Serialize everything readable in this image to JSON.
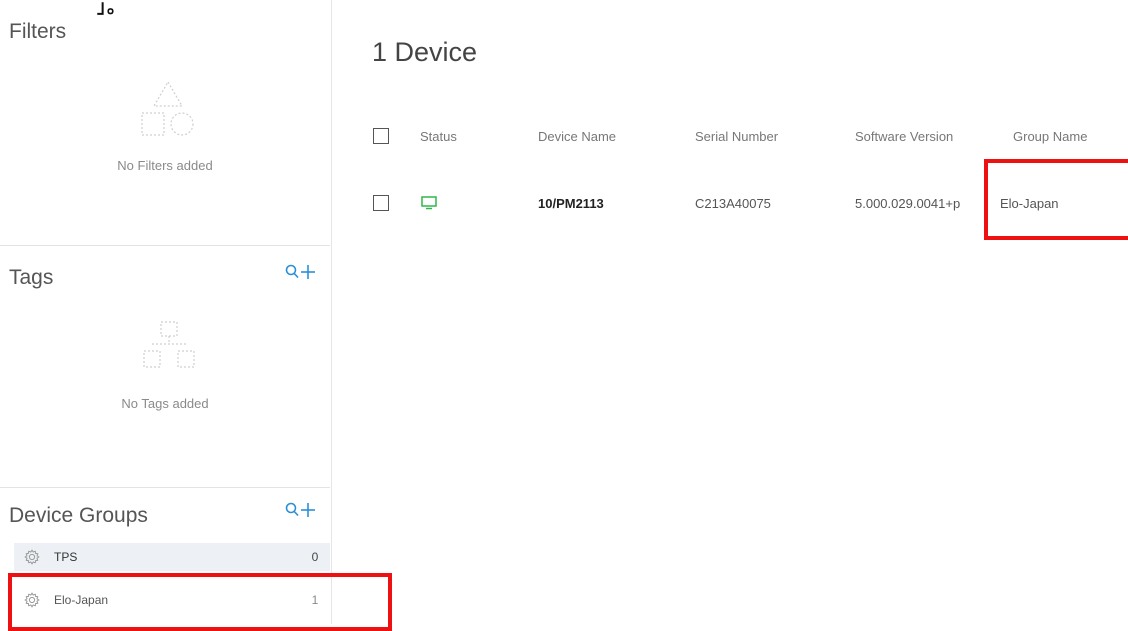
{
  "top_mark": "」。",
  "filters": {
    "title": "Filters",
    "empty_text": "No Filters added"
  },
  "tags": {
    "title": "Tags",
    "empty_text": "No Tags added"
  },
  "device_groups": {
    "title": "Device Groups",
    "items": [
      {
        "name": "TPS",
        "count": "0",
        "selected": true
      },
      {
        "name": "Elo-Japan",
        "count": "1",
        "selected": false
      }
    ]
  },
  "main": {
    "title": "1 Device",
    "columns": [
      "Status",
      "Device Name",
      "Serial Number",
      "Software Version",
      "Group Name"
    ],
    "rows": [
      {
        "status": "online",
        "device_name": "10/PM2113",
        "serial_number": "C213A40075",
        "software_version": "5.000.029.0041+p",
        "group_name": "Elo-Japan"
      }
    ]
  },
  "colors": {
    "accent": "#2a8fd6",
    "status_online": "#2fb84a",
    "highlight": "#ee1111",
    "selected_row": "#edf1f6"
  },
  "icons": {
    "filters_placeholder": "shapes-icon",
    "tags_placeholder": "hierarchy-icon",
    "group_icon": "gear-icon",
    "status_icon": "monitor-icon",
    "search_add": "search-add-icon"
  }
}
